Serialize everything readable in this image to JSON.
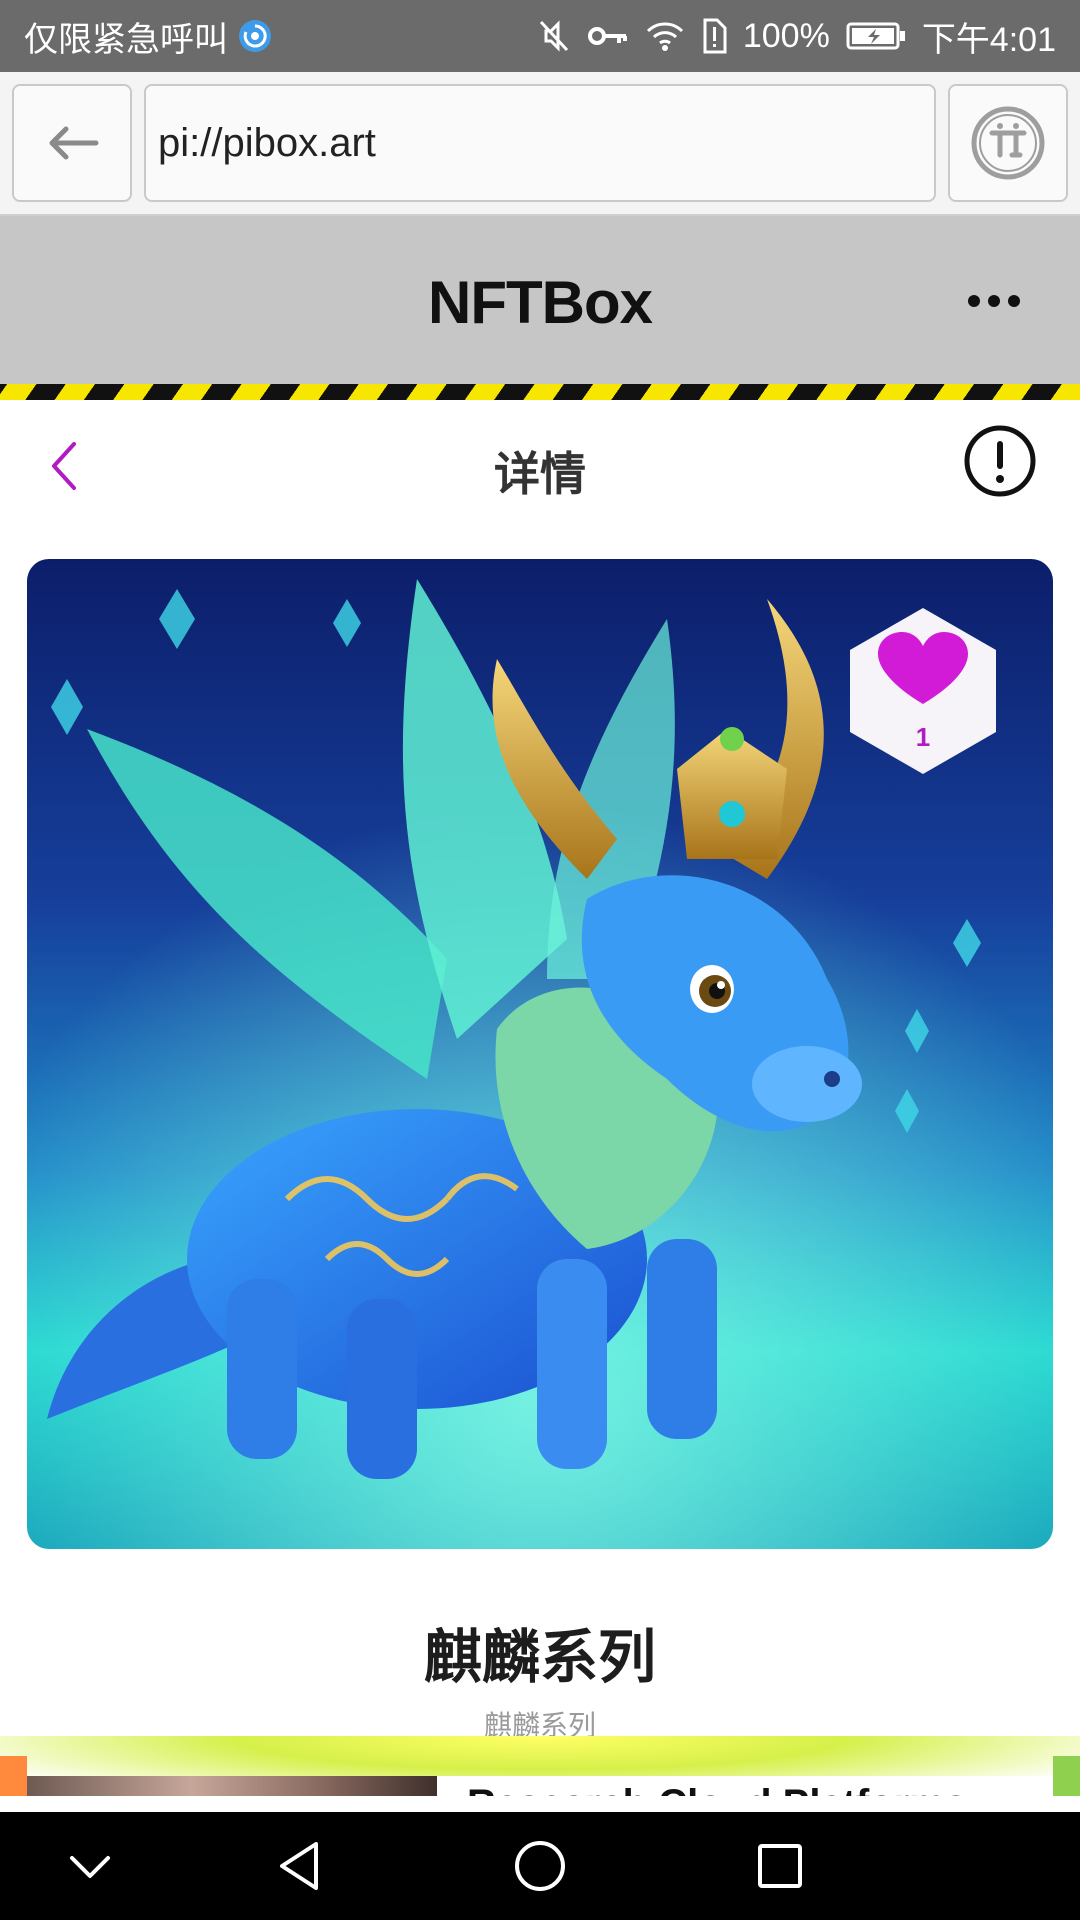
{
  "status_bar": {
    "carrier_text": "仅限紧急呼叫",
    "battery_percent": "100%",
    "time": "下午4:01"
  },
  "browser": {
    "url": "pi://pibox.art"
  },
  "app": {
    "title": "NFTBox"
  },
  "detail": {
    "title": "详情"
  },
  "nft": {
    "like_count": "1",
    "title": "麒麟系列",
    "subtitle": "麒麟系列"
  },
  "ad": {
    "headline": "Research Cloud Platforms"
  },
  "colors": {
    "status_bar_bg": "#6b6b6b",
    "app_header_bg": "#c6c6c6",
    "accent_purple": "#b01cc0",
    "heart_magenta": "#d21bd6",
    "hazard_yellow": "#f7e600"
  }
}
